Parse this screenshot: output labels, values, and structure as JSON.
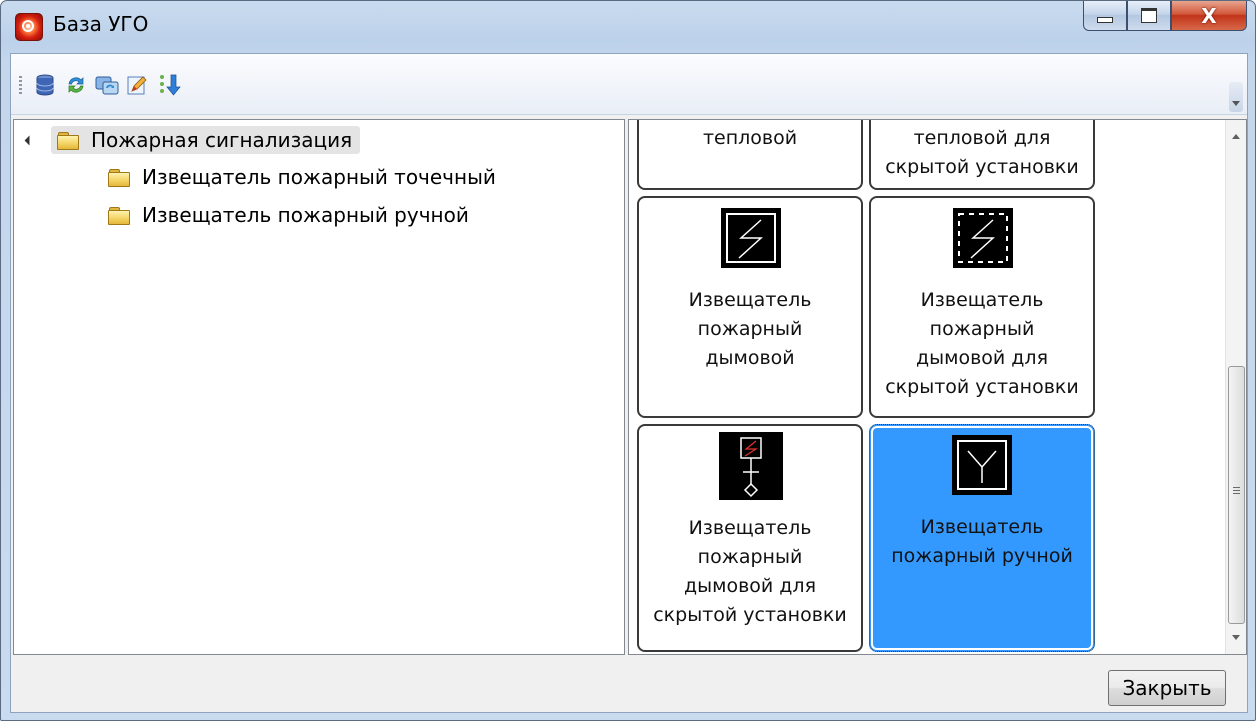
{
  "window": {
    "title": "База УГО",
    "close_glyph": "X"
  },
  "toolbar": {
    "buttons": [
      {
        "name": "database-icon"
      },
      {
        "name": "refresh-icon"
      },
      {
        "name": "sync-icon"
      },
      {
        "name": "edit-icon"
      },
      {
        "name": "sort-download-icon"
      }
    ]
  },
  "tree": {
    "root": {
      "label": "Пожарная сигнализация",
      "expanded": true,
      "selected": true
    },
    "children": [
      {
        "label": "Извещатель пожарный точечный"
      },
      {
        "label": "Извещатель пожарный ручной"
      }
    ]
  },
  "items": [
    {
      "label": "тепловой"
    },
    {
      "label": "тепловой для\nскрытой установки"
    },
    {
      "label": "Извещатель\nпожарный\nдымовой",
      "icon": "smoke-detector-icon"
    },
    {
      "label": "Извещатель\nпожарный\nдымовой для\nскрытой установки",
      "icon": "hidden-smoke-detector-icon"
    },
    {
      "label": "Извещатель\nпожарный\nдымовой для\nскрытой установки",
      "icon": "wired-smoke-detector-icon"
    },
    {
      "label": "Извещатель\nпожарный ручной",
      "icon": "manual-call-point-icon",
      "selected": true
    }
  ],
  "footer": {
    "close_label": "Закрыть"
  },
  "colors": {
    "selection": "#3399ff",
    "window_frame": "#bcd1ea"
  }
}
